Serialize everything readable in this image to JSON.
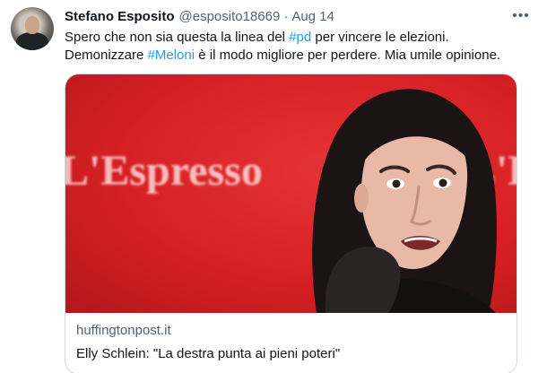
{
  "tweet": {
    "author_name": "Stefano Esposito",
    "handle": "@esposito18669",
    "separator": "·",
    "date": "Aug 14",
    "more_icon": "more-horizontal-icon",
    "text": {
      "line1_before": "Spero che non sia questa la linea del ",
      "line1_tag": "#pd",
      "line1_after": " per vincere le elezioni.",
      "line2_before": "Demonizzare ",
      "line2_tag": "#Meloni",
      "line2_after": " è il modo migliore per perdere. Mia umile opinione."
    },
    "hashtag_color": "#1d9bf0"
  },
  "card": {
    "image_brand_text": "L'Espresso",
    "image_brand_text_2": "L'E",
    "domain": "huffingtonpost.it",
    "headline": "Elly Schlein: \"La destra punta ai pieni poteri\""
  }
}
